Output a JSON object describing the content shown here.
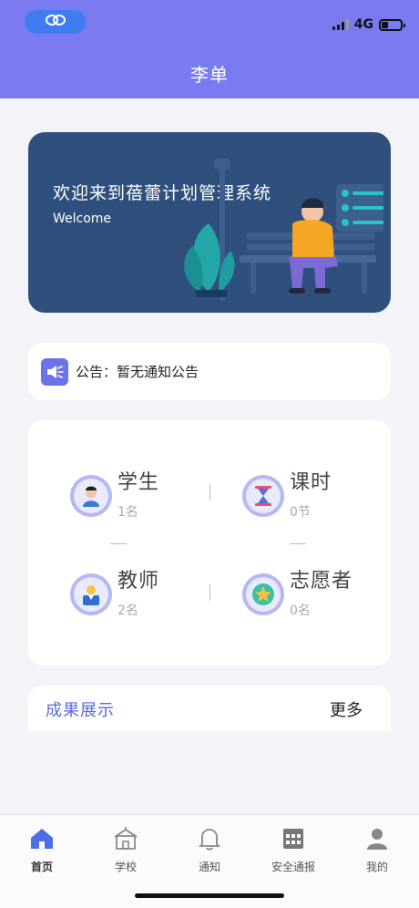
{
  "status": {
    "network": "4G"
  },
  "header": {
    "title": "李单"
  },
  "banner": {
    "title": "欢迎来到蓓蕾计划管理系统",
    "subtitle": "Welcome"
  },
  "notice": {
    "label": "公告：",
    "text": "暂无通知公告"
  },
  "stats": [
    {
      "label": "学生",
      "value": "1名",
      "icon": "student-icon"
    },
    {
      "label": "课时",
      "value": "0节",
      "icon": "hourglass-icon"
    },
    {
      "label": "教师",
      "value": "2名",
      "icon": "teacher-icon"
    },
    {
      "label": "志愿者",
      "value": "0名",
      "icon": "star-icon"
    }
  ],
  "achievements": {
    "title": "成果展示",
    "more": "更多"
  },
  "tabs": [
    {
      "label": "首页",
      "icon": "home-icon",
      "active": true
    },
    {
      "label": "学校",
      "icon": "school-icon",
      "active": false
    },
    {
      "label": "通知",
      "icon": "bell-icon",
      "active": false
    },
    {
      "label": "安全通报",
      "icon": "grid-calendar-icon",
      "active": false
    },
    {
      "label": "我的",
      "icon": "user-icon",
      "active": false
    }
  ],
  "colors": {
    "primary": "#7a7bf0",
    "banner": "#2f4f7c",
    "accent": "#5a6ce0"
  }
}
